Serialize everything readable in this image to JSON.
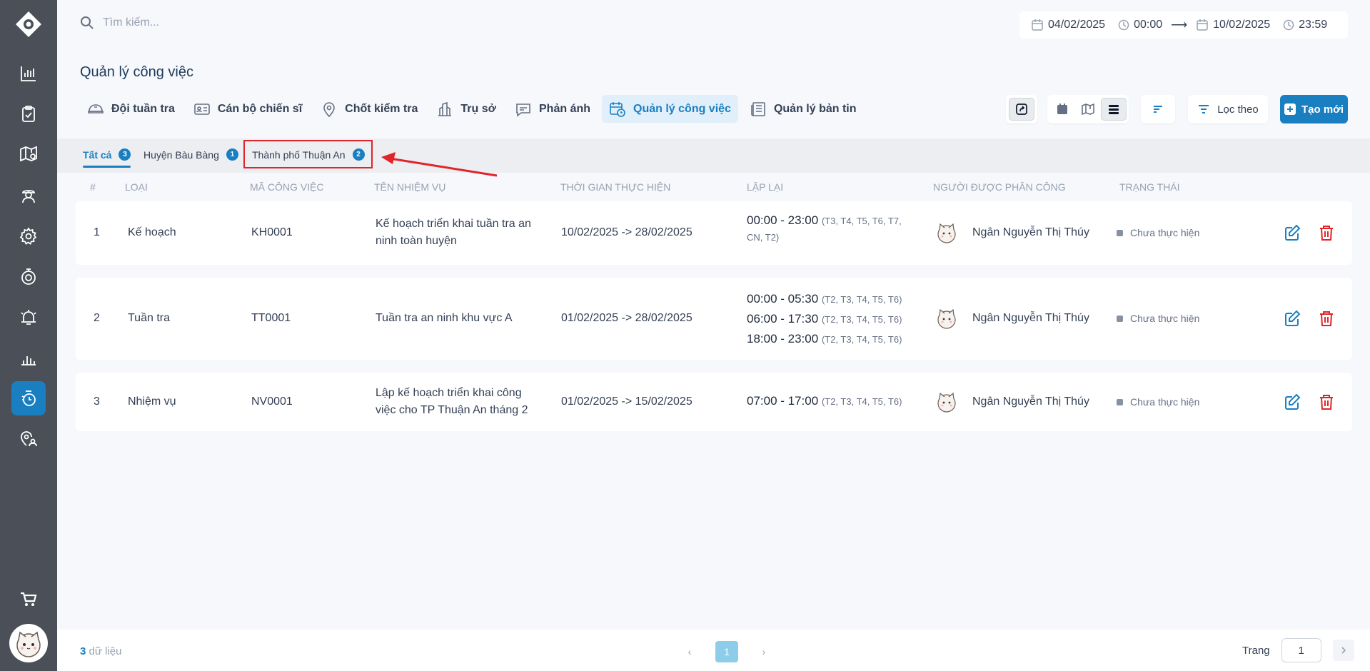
{
  "search": {
    "placeholder": "Tìm kiếm..."
  },
  "daterange": {
    "from_date": "04/02/2025",
    "from_time": "00:00",
    "to_date": "10/02/2025",
    "to_time": "23:59"
  },
  "page": {
    "title": "Quản lý công việc"
  },
  "tabs": [
    {
      "label": "Đội tuần tra",
      "icon": "patrol-cap-icon"
    },
    {
      "label": "Cán bộ chiến sĩ",
      "icon": "id-card-icon"
    },
    {
      "label": "Chốt kiểm tra",
      "icon": "map-pin-icon"
    },
    {
      "label": "Trụ sở",
      "icon": "building-icon"
    },
    {
      "label": "Phản ánh",
      "icon": "chat-icon"
    },
    {
      "label": "Quản lý công việc",
      "icon": "calendar-clock-icon",
      "active": true
    },
    {
      "label": "Quản lý bản tin",
      "icon": "newspaper-icon"
    }
  ],
  "toolbar": {
    "filter_label": "Lọc theo",
    "create_label": "Tạo mới"
  },
  "subtabs": [
    {
      "label": "Tất cả",
      "count": "3",
      "active": true
    },
    {
      "label": "Huyện Bàu Bàng",
      "count": "1"
    },
    {
      "label": "Thành phố Thuận An",
      "count": "2"
    }
  ],
  "columns": [
    "#",
    "Loại",
    "Mã công việc",
    "Tên nhiệm vụ",
    "Thời gian thực hiện",
    "Lặp lại",
    "Người được phân công",
    "Trạng thái"
  ],
  "rows": [
    {
      "no": "1",
      "type": "Kế hoạch",
      "code": "KH0001",
      "name1": "Kế hoạch triển khai tuần tra an",
      "name2": "ninh toàn huyện",
      "period": "10/02/2025 -> 28/02/2025",
      "repeat": [
        {
          "time": "00:00 - 23:00",
          "days": "(T3, T4, T5, T6, T7,",
          "days2": "CN, T2)"
        }
      ],
      "assignee": "Ngân Nguyễn Thị Thúy",
      "status": "Chưa thực hiện"
    },
    {
      "no": "2",
      "type": "Tuần tra",
      "code": "TT0001",
      "name1": "Tuần tra an ninh khu vực A",
      "name2": "",
      "period": "01/02/2025 -> 28/02/2025",
      "repeat": [
        {
          "time": "00:00 - 05:30",
          "days": "(T2, T3, T4, T5, T6)"
        },
        {
          "time": "06:00 - 17:30",
          "days": "(T2, T3, T4, T5, T6)"
        },
        {
          "time": "18:00 - 23:00",
          "days": "(T2, T3, T4, T5, T6)"
        }
      ],
      "assignee": "Ngân Nguyễn Thị Thúy",
      "status": "Chưa thực hiện"
    },
    {
      "no": "3",
      "type": "Nhiệm vụ",
      "code": "NV0001",
      "name1": "Lập kế hoạch triển khai công",
      "name2": "việc cho TP Thuận An tháng 2",
      "period": "01/02/2025 -> 15/02/2025",
      "repeat": [
        {
          "time": "07:00 - 17:00",
          "days": "(T2, T3, T4, T5, T6)"
        }
      ],
      "assignee": "Ngân Nguyễn Thị Thúy",
      "status": "Chưa thực hiện"
    }
  ],
  "footer": {
    "count": "3",
    "count_label": "dữ liệu",
    "current_page": "1",
    "page_label": "Trang",
    "page_input": "1"
  },
  "colors": {
    "accent": "#1a7fc1",
    "sidebar": "#4b5058",
    "delete": "#e0242a",
    "annotation": "#e0242a"
  }
}
